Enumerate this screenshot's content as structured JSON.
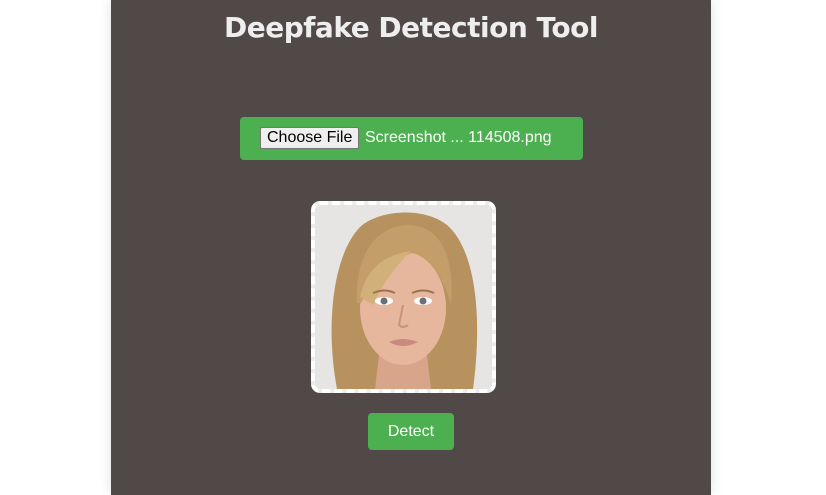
{
  "page": {
    "title": "Deepfake Detection Tool"
  },
  "upload": {
    "choose_label": "Choose File",
    "file_name": "Screenshot ... 114508.png"
  },
  "preview": {
    "alt": "Uploaded face image preview"
  },
  "actions": {
    "detect_label": "Detect"
  },
  "colors": {
    "panel_bg": "#514848",
    "accent_green": "#4caf50",
    "title_text": "#eeeeee"
  }
}
